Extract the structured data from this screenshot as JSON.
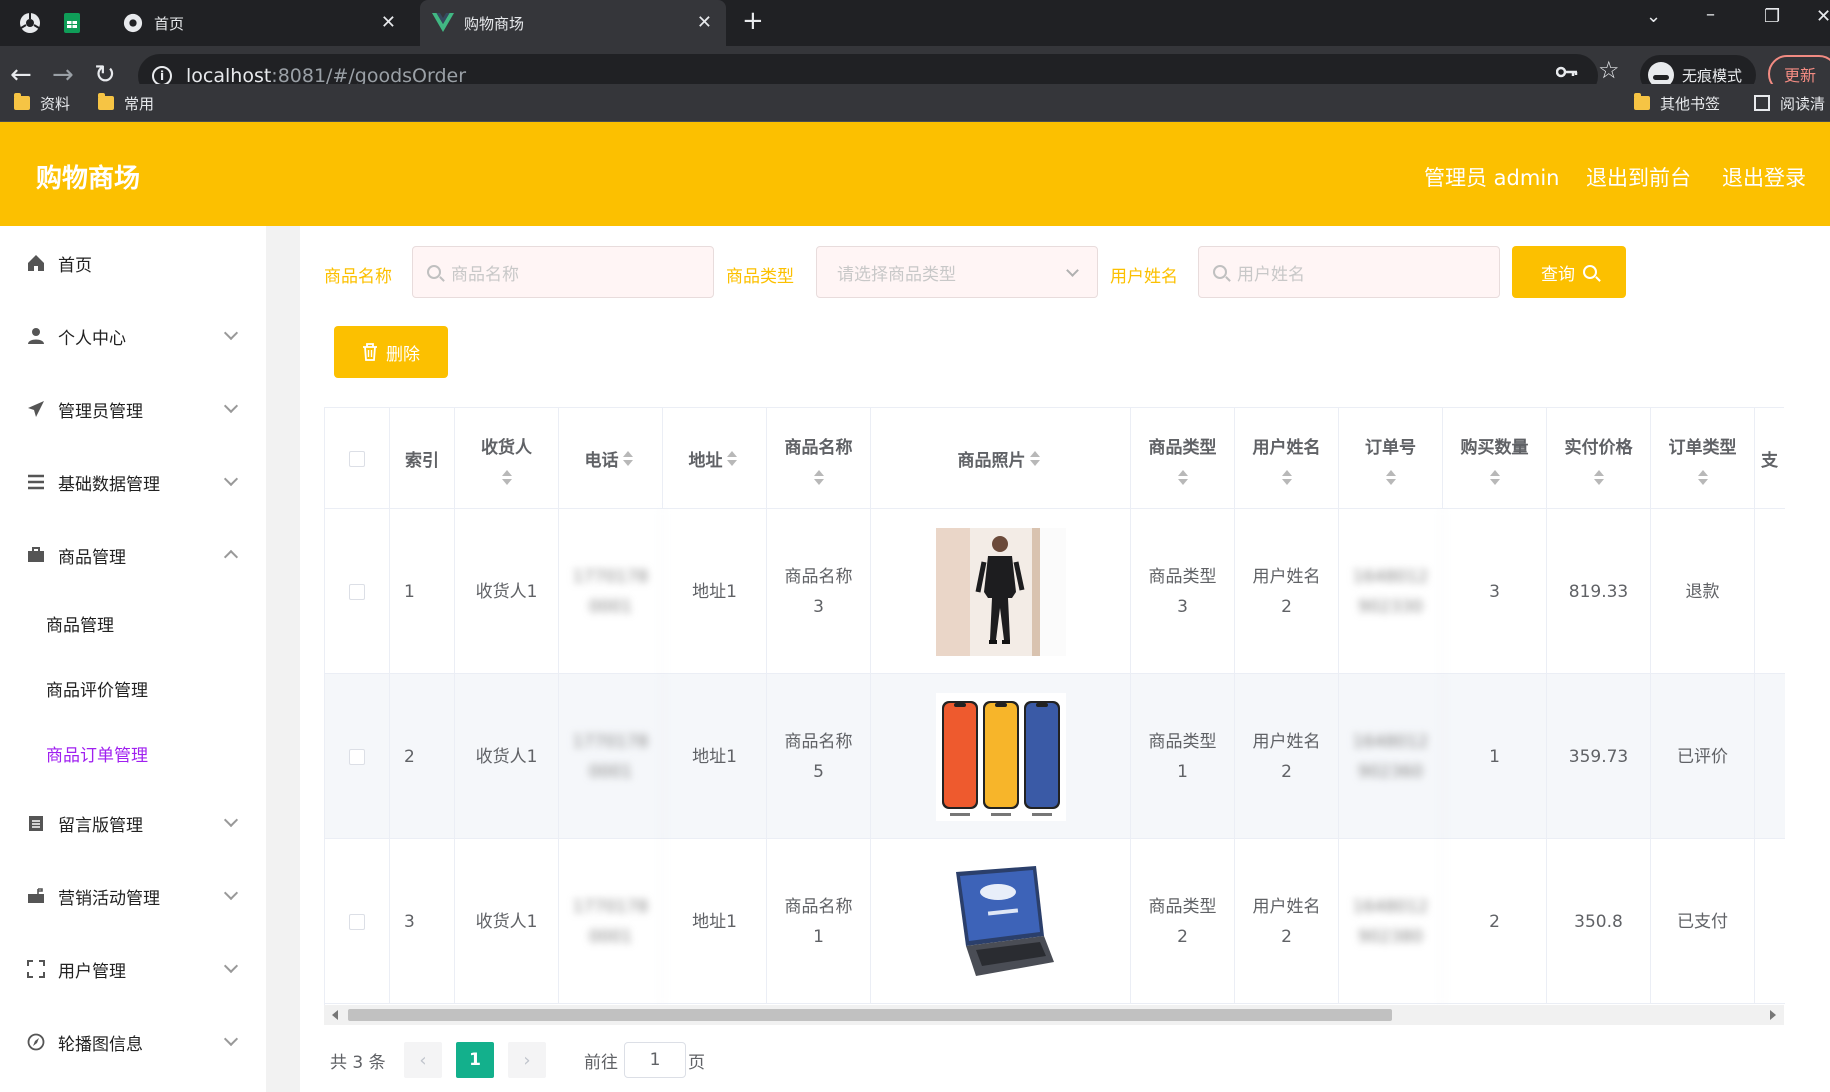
{
  "browser": {
    "tabs": [
      {
        "label": "首页",
        "active": false
      },
      {
        "label": "购物商场",
        "active": true
      }
    ],
    "url_host": "localhost",
    "url_path": ":8081/#/goodsOrder",
    "incognito_label": "无痕模式",
    "update_label": "更新",
    "bookmarks": [
      "资料",
      "常用"
    ],
    "bookmarks_right": [
      "其他书签",
      "阅读清"
    ]
  },
  "header": {
    "title": "购物商场",
    "admin_label": "管理员 admin",
    "to_front": "退出到前台",
    "logout": "退出登录"
  },
  "sidebar": {
    "items": [
      {
        "label": "首页",
        "icon": "home-icon"
      },
      {
        "label": "个人中心",
        "icon": "user-icon"
      },
      {
        "label": "管理员管理",
        "icon": "send-icon"
      },
      {
        "label": "基础数据管理",
        "icon": "list-icon"
      },
      {
        "label": "商品管理",
        "icon": "briefcase-icon"
      },
      {
        "label": "留言版管理",
        "icon": "clipboard-icon"
      },
      {
        "label": "营销活动管理",
        "icon": "mailbox-icon"
      },
      {
        "label": "用户管理",
        "icon": "frame-icon"
      },
      {
        "label": "轮播图信息",
        "icon": "compass-icon"
      }
    ],
    "sub_items": [
      "商品管理",
      "商品评价管理",
      "商品订单管理"
    ],
    "active_sub": "商品订单管理"
  },
  "filters": {
    "goods_name_label": "商品名称",
    "goods_name_placeholder": "商品名称",
    "goods_type_label": "商品类型",
    "goods_type_placeholder": "请选择商品类型",
    "user_name_label": "用户姓名",
    "user_name_placeholder": "用户姓名",
    "query_label": "查询",
    "delete_label": "删除"
  },
  "table": {
    "headers": [
      "索引",
      "收货人",
      "电话",
      "地址",
      "商品名称",
      "商品照片",
      "商品类型",
      "用户姓名",
      "订单号",
      "购买数量",
      "实付价格",
      "订单类型",
      "支"
    ],
    "rows": [
      {
        "index": "1",
        "receiver": "收货人1",
        "phone_1": "1770178",
        "phone_2": "0001",
        "address": "地址1",
        "goods_name_1": "商品名称",
        "goods_name_2": "3",
        "goods_type_1": "商品类型",
        "goods_type_2": "3",
        "user_1": "用户姓名",
        "user_2": "2",
        "order_1": "1648012",
        "order_2": "902330",
        "qty": "3",
        "price": "819.33",
        "order_type": "退款",
        "image": "suit-photo"
      },
      {
        "index": "2",
        "receiver": "收货人1",
        "phone_1": "1770178",
        "phone_2": "0001",
        "address": "地址1",
        "goods_name_1": "商品名称",
        "goods_name_2": "5",
        "goods_type_1": "商品类型",
        "goods_type_2": "1",
        "user_1": "用户姓名",
        "user_2": "2",
        "order_1": "1648012",
        "order_2": "902360",
        "qty": "1",
        "price": "359.73",
        "order_type": "已评价",
        "image": "phones-photo"
      },
      {
        "index": "3",
        "receiver": "收货人1",
        "phone_1": "1770178",
        "phone_2": "0001",
        "address": "地址1",
        "goods_name_1": "商品名称",
        "goods_name_2": "1",
        "goods_type_1": "商品类型",
        "goods_type_2": "2",
        "user_1": "用户姓名",
        "user_2": "2",
        "order_1": "1648012",
        "order_2": "902380",
        "qty": "2",
        "price": "350.8",
        "order_type": "已支付",
        "image": "laptop-photo"
      }
    ]
  },
  "pagination": {
    "total": "共 3 条",
    "current": "1",
    "goto_label": "前往",
    "goto_value": "1",
    "page_suffix": "页"
  },
  "colors": {
    "accent": "#fcc000",
    "active_sub": "#a020f0",
    "page_current": "#13b08c"
  }
}
